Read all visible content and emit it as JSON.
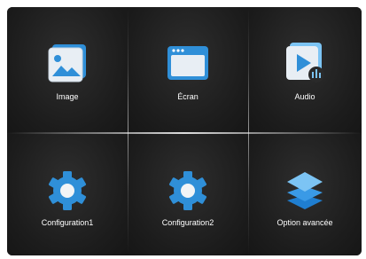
{
  "menu": {
    "items": [
      {
        "label": "Image",
        "icon": "image-icon"
      },
      {
        "label": "Écran",
        "icon": "screen-window-icon"
      },
      {
        "label": "Audio",
        "icon": "audio-icon"
      },
      {
        "label": "Configuration1",
        "icon": "gear-icon"
      },
      {
        "label": "Configuration2",
        "icon": "gear-icon"
      },
      {
        "label": "Option avancée",
        "icon": "layers-icon"
      }
    ]
  },
  "colors": {
    "panel_bg": "#1c1c1c",
    "icon_blue": "#2f8fd8",
    "icon_light_blue": "#7cc4f4",
    "text": "#ffffff"
  }
}
